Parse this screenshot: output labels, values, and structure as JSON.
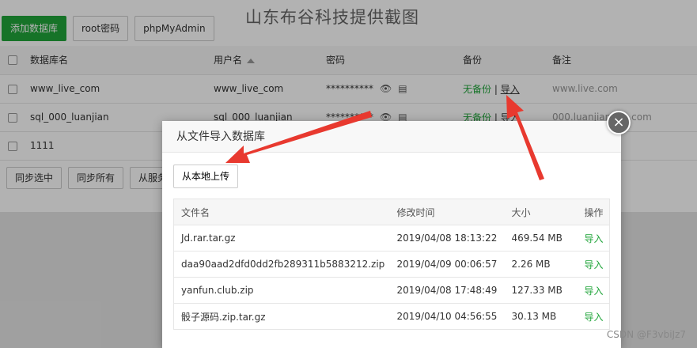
{
  "watermark_title": "山东布谷科技提供截图",
  "toolbar": {
    "add_db": "添加数据库",
    "root_pwd": "root密码",
    "phpmyadmin": "phpMyAdmin"
  },
  "db_table": {
    "headers": {
      "name": "数据库名",
      "user": "用户名",
      "password": "密码",
      "backup": "备份",
      "note": "备注"
    },
    "rows": [
      {
        "name": "www_live_com",
        "user": "www_live_com",
        "password": "**********",
        "backup_status": "无备份",
        "import": "导入",
        "note": "www.live.com"
      },
      {
        "name": "sql_000_luanjian",
        "user": "sql_000_luanjian",
        "password": "**********",
        "backup_status": "无备份",
        "import": "导入",
        "note": "000.luanjianbao.com"
      },
      {
        "name": "1111",
        "user": "",
        "password": "",
        "backup_status": "",
        "import": "",
        "note": ""
      }
    ]
  },
  "bottom_bar": {
    "sync_selected": "同步选中",
    "sync_all": "同步所有",
    "from_server": "从服务"
  },
  "modal": {
    "title": "从文件导入数据库",
    "upload_label": "从本地上传",
    "close_symbol": "×",
    "file_headers": {
      "name": "文件名",
      "mtime": "修改时间",
      "size": "大小",
      "op": "操作"
    },
    "files": [
      {
        "name": "Jd.rar.tar.gz",
        "mtime": "2019/04/08 18:13:22",
        "size": "469.54 MB",
        "op": "导入"
      },
      {
        "name": "daa90aad2dfd0dd2fb289311b5883212.zip",
        "mtime": "2019/04/09 00:06:57",
        "size": "2.26 MB",
        "op": "导入"
      },
      {
        "name": "yanfun.club.zip",
        "mtime": "2019/04/08 17:48:49",
        "size": "127.33 MB",
        "op": "导入"
      },
      {
        "name": "骰子源码.zip.tar.gz",
        "mtime": "2019/04/10 04:56:55",
        "size": "30.13 MB",
        "op": "导入"
      }
    ]
  },
  "csdn_watermark": "CSDN @F3vbiJz7",
  "colors": {
    "green": "#20a53a",
    "arrow_red": "#e8392f"
  }
}
